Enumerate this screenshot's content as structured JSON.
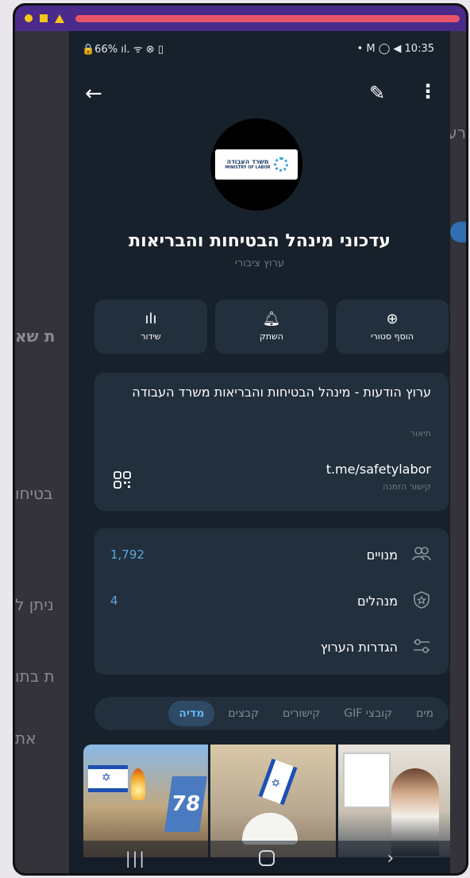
{
  "status_bar": {
    "left": "🔒66% ıl. ᯤ ⊗ ▯",
    "right": "• M ◯ ◀ 10:35"
  },
  "background_app": {
    "fragments": [
      "רע",
      "ת שא",
      "בטיחו",
      "ניתן ל",
      "ת בתו",
      "את"
    ]
  },
  "channel": {
    "name": "עדכוני מינהל הבטיחות והבריאות",
    "type": "ערוץ ציבורי",
    "logo_text": "משרד העבודה",
    "logo_subtext": "MINISTRY OF LABOR"
  },
  "actions": [
    {
      "icon": "broadcast-icon",
      "label": "שידור"
    },
    {
      "icon": "bell-icon",
      "label": "השתק"
    },
    {
      "icon": "add-story-icon",
      "label": "הוסף סטורי"
    }
  ],
  "info": {
    "description": "ערוץ הודעות - מינהל הבטיחות והבריאות משרד העבודה",
    "description_label": "תיאור",
    "link": "t.me/safetylabor",
    "link_label": "קישור הזמנה"
  },
  "stats": [
    {
      "icon": "subscribers-icon",
      "label": "מנויים",
      "value": "1,792"
    },
    {
      "icon": "admins-icon",
      "label": "מנהלים",
      "value": "4"
    },
    {
      "icon": "settings-sliders-icon",
      "label": "הגדרות הערוץ",
      "value": ""
    }
  ],
  "tabs": [
    {
      "label": "מדיה",
      "active": true
    },
    {
      "label": "קבצים",
      "active": false
    },
    {
      "label": "קישורים",
      "active": false
    },
    {
      "label": "קובצי GIF",
      "active": false
    },
    {
      "label": "מים",
      "active": false
    }
  ],
  "media": {
    "photo2_sign": "78"
  },
  "colors": {
    "background": "#17212b",
    "card": "#222f3d",
    "accent": "#64b5ef",
    "muted": "#6d7883",
    "titlebar": "#4a2a8a"
  }
}
